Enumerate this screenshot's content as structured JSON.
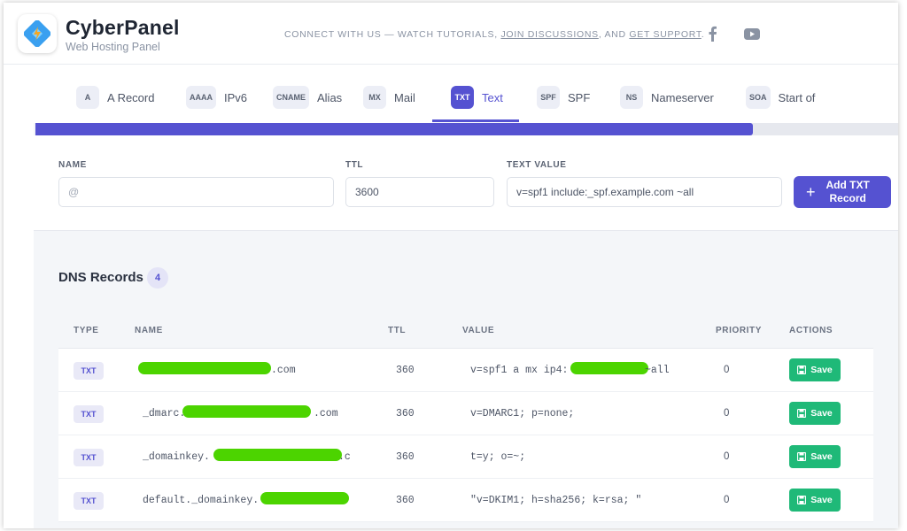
{
  "header": {
    "brand_title": "CyberPanel",
    "brand_subtitle": "Web Hosting Panel",
    "connect_prefix": "CONNECT WITH US — WATCH TUTORIALS, ",
    "connect_link1": "JOIN DISCUSSIONS",
    "connect_mid": ", AND ",
    "connect_link2": "GET SUPPORT",
    "connect_suffix": ".",
    "social_icons": [
      "facebook-icon",
      "youtube-icon"
    ]
  },
  "tabs": [
    {
      "code": "A",
      "label": "A Record",
      "active": false
    },
    {
      "code": "AAAA",
      "label": "IPv6",
      "active": false
    },
    {
      "code": "CNAME",
      "label": "Alias",
      "active": false
    },
    {
      "code": "MX",
      "label": "Mail",
      "active": false
    },
    {
      "code": "TXT",
      "label": "Text",
      "active": true
    },
    {
      "code": "SPF",
      "label": "SPF",
      "active": false
    },
    {
      "code": "NS",
      "label": "Nameserver",
      "active": false
    },
    {
      "code": "SOA",
      "label": "Start of ",
      "active": false
    }
  ],
  "progress": {
    "percent": 82
  },
  "form": {
    "name_label": "NAME",
    "name_placeholder": "@",
    "ttl_label": "TTL",
    "ttl_value": "3600",
    "text_label": "TEXT VALUE",
    "text_value": "v=spf1 include:_spf.example.com ~all",
    "add_button_line1": "Add TXT",
    "add_button_line2": "Record"
  },
  "records": {
    "title": "DNS Records",
    "count": "4",
    "columns": {
      "type": "TYPE",
      "name": "NAME",
      "ttl": "TTL",
      "value": "VALUE",
      "priority": "PRIORITY",
      "actions": "ACTIONS"
    },
    "save_label": "Save",
    "rows": [
      {
        "type": "TXT",
        "name": ".com",
        "ttl": "360",
        "value_start": "v=spf1 a mx ip4:",
        "value_end": " ~all",
        "priority": "0"
      },
      {
        "type": "TXT",
        "name": "_dmarc.",
        "name_end": ".com",
        "ttl": "360",
        "value_start": "v=DMARC1; p=none;",
        "value_end": "",
        "priority": "0"
      },
      {
        "type": "TXT",
        "name": "_domainkey.",
        "name_end": ".c",
        "ttl": "360",
        "value_start": "t=y; o=~;",
        "value_end": "",
        "priority": "0"
      },
      {
        "type": "TXT",
        "name": "default._domainkey.",
        "name_end": "",
        "ttl": "360",
        "value_start": "\"v=DKIM1; h=sha256; k=rsa; \"",
        "value_end": "",
        "priority": "0"
      }
    ]
  },
  "colors": {
    "accent": "#5552d1",
    "save": "#1fb978",
    "redaction": "#4cd400"
  }
}
